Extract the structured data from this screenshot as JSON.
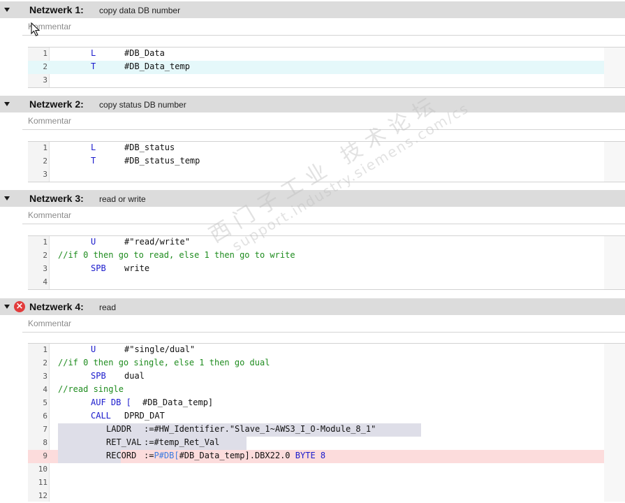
{
  "comment_placeholder": "Kommentar",
  "networks": [
    {
      "title": "Netzwerk 1:",
      "desc": "copy data DB number",
      "lines": [
        {
          "n": "1",
          "op": "L",
          "arg": "#DB_Data"
        },
        {
          "n": "2",
          "op": "T",
          "arg": "#DB_Data_temp"
        },
        {
          "n": "3"
        }
      ]
    },
    {
      "title": "Netzwerk 2:",
      "desc": "copy status DB number",
      "lines": [
        {
          "n": "1",
          "op": "L",
          "arg": "#DB_status"
        },
        {
          "n": "2",
          "op": "T",
          "arg": "#DB_status_temp"
        },
        {
          "n": "3"
        }
      ]
    },
    {
      "title": "Netzwerk 3:",
      "desc": "read or write",
      "lines": [
        {
          "n": "1",
          "op": "U",
          "arg": "#\"read/write\""
        },
        {
          "n": "2",
          "comment": "//if 0 then go to read, else 1 then go to write"
        },
        {
          "n": "3",
          "op": "SPB",
          "arg": "write"
        },
        {
          "n": "4"
        }
      ]
    },
    {
      "title": "Netzwerk 4:",
      "desc": "read",
      "error_icon": "error-circle-icon",
      "lines": [
        {
          "n": "1",
          "op": "U",
          "arg": "#\"single/dual\""
        },
        {
          "n": "2",
          "comment": "//if 0 then go single, else 1 then go dual"
        },
        {
          "n": "3",
          "op": "SPB",
          "arg": "dual"
        },
        {
          "n": "4",
          "comment": "//read single"
        },
        {
          "n": "5",
          "op": "AUF DB [",
          "arg": "#DB_Data_temp]"
        },
        {
          "n": "6",
          "op": "CALL",
          "arg": "DPRD_DAT"
        },
        {
          "n": "7",
          "param": "LADDR",
          "assign": ":=#HW_Identifier.\"Slave_1~AWS3_I_O-Module_8_1\""
        },
        {
          "n": "8",
          "param": "RET_VAL",
          "assign": ":=#temp_Ret_Val"
        },
        {
          "n": "9",
          "param": "RECORD",
          "assign_pre": ":=",
          "assign_kw": "P#DB[",
          "assign_mid": "#DB_Data_temp].DBX22.0",
          "assign_kw2": "BYTE 8"
        },
        {
          "n": "10"
        },
        {
          "n": "11"
        },
        {
          "n": "12"
        }
      ]
    }
  ],
  "watermark": {
    "line1": "西门子工业 技术论坛",
    "line2": "support.industry.siemens.com/cs"
  },
  "colors": {
    "keyword": "#1a1acc",
    "comment": "#1f8c1f",
    "header_bg": "#dcdcdc",
    "highlight_cyan": "#e5f8fa",
    "highlight_error": "#fcdcdc"
  }
}
